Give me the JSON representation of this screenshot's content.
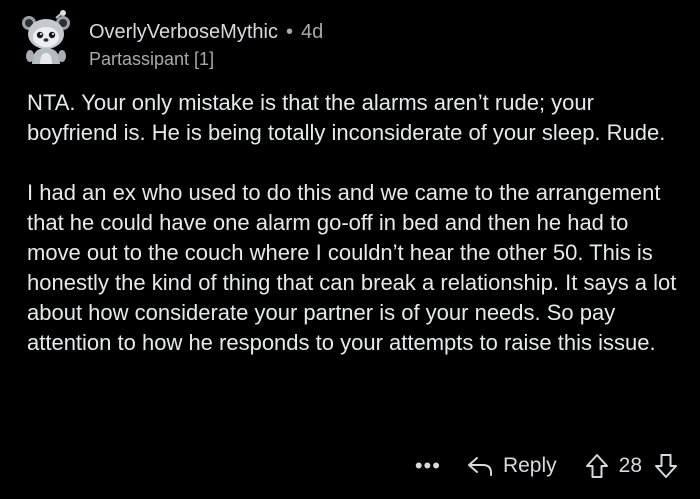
{
  "comment": {
    "author": "OverlyVerboseMythic",
    "separator": "•",
    "age": "4d",
    "flair": "Partassipant [1]",
    "avatar_icon": "snoo-avatar-icon",
    "paragraphs": [
      "NTA. Your only mistake is that the alarms aren’t rude; your boyfriend is. He is being totally inconsiderate of your sleep. Rude.",
      "I had an ex who used to do this and we came to the arrangement that he could have one alarm go-off in bed and then he had to move out to the couch where I couldn’t hear the other 50. This is honestly the kind of thing that can break a relationship. It says a lot about how considerate your partner is of your needs. So pay attention to how he responds to your attempts to raise this issue."
    ]
  },
  "actions": {
    "more_label": "•••",
    "reply_label": "Reply",
    "reply_icon": "reply-arrow-icon",
    "upvote_icon": "upvote-arrow-icon",
    "downvote_icon": "downvote-arrow-icon",
    "score": "28"
  },
  "colors": {
    "background": "#000000",
    "text": "#e7e9ea",
    "muted": "#a8aaab"
  }
}
